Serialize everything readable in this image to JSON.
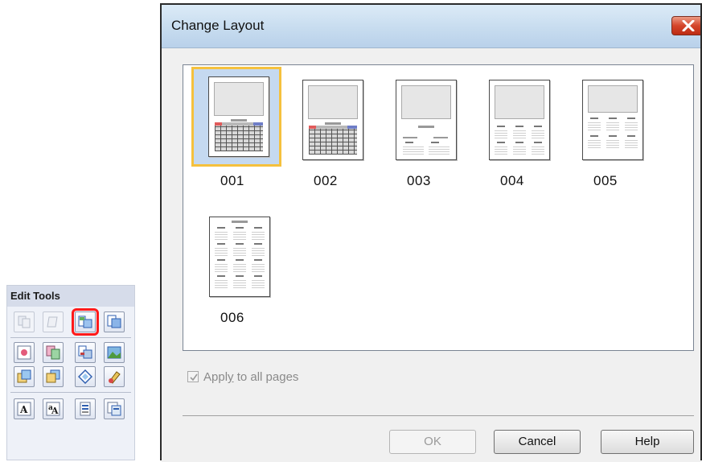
{
  "edit_tools": {
    "title": "Edit Tools",
    "buttons": [
      {
        "icon": "copy-page-icon",
        "enabled": false
      },
      {
        "icon": "paste-page-icon",
        "enabled": false
      },
      {
        "icon": "change-layout-icon",
        "enabled": true,
        "highlighted": true
      },
      {
        "icon": "change-page-icon",
        "enabled": true
      },
      {
        "icon": "add-image-icon",
        "enabled": true
      },
      {
        "icon": "image-effects-icon",
        "enabled": true
      },
      {
        "icon": "crop-icon",
        "enabled": true
      },
      {
        "icon": "background-icon",
        "enabled": true
      },
      {
        "icon": "bring-forward-icon",
        "enabled": true
      },
      {
        "icon": "send-backward-icon",
        "enabled": true
      },
      {
        "icon": "frame-icon",
        "enabled": true
      },
      {
        "icon": "color-icon",
        "enabled": true
      },
      {
        "icon": "add-text-icon",
        "enabled": true
      },
      {
        "icon": "vertical-text-icon",
        "enabled": true
      },
      {
        "icon": "date-settings-icon",
        "enabled": true
      },
      {
        "icon": "calendar-settings-icon",
        "enabled": true
      }
    ],
    "highlight_color": "#ff1a1a"
  },
  "dialog": {
    "title": "Change Layout",
    "close_icon": "close-icon",
    "layouts": [
      {
        "label": "001",
        "selected": true
      },
      {
        "label": "002",
        "selected": false
      },
      {
        "label": "003",
        "selected": false
      },
      {
        "label": "004",
        "selected": false
      },
      {
        "label": "005",
        "selected": false
      },
      {
        "label": "006",
        "selected": false
      }
    ],
    "apply_all": {
      "label_pre": "Appl",
      "label_mnemonic": "y",
      "label_post": " to all pages",
      "checked": true,
      "enabled": false
    },
    "buttons": {
      "ok": "OK",
      "cancel": "Cancel",
      "help": "Help"
    },
    "selection_color": "#f5c13d"
  }
}
